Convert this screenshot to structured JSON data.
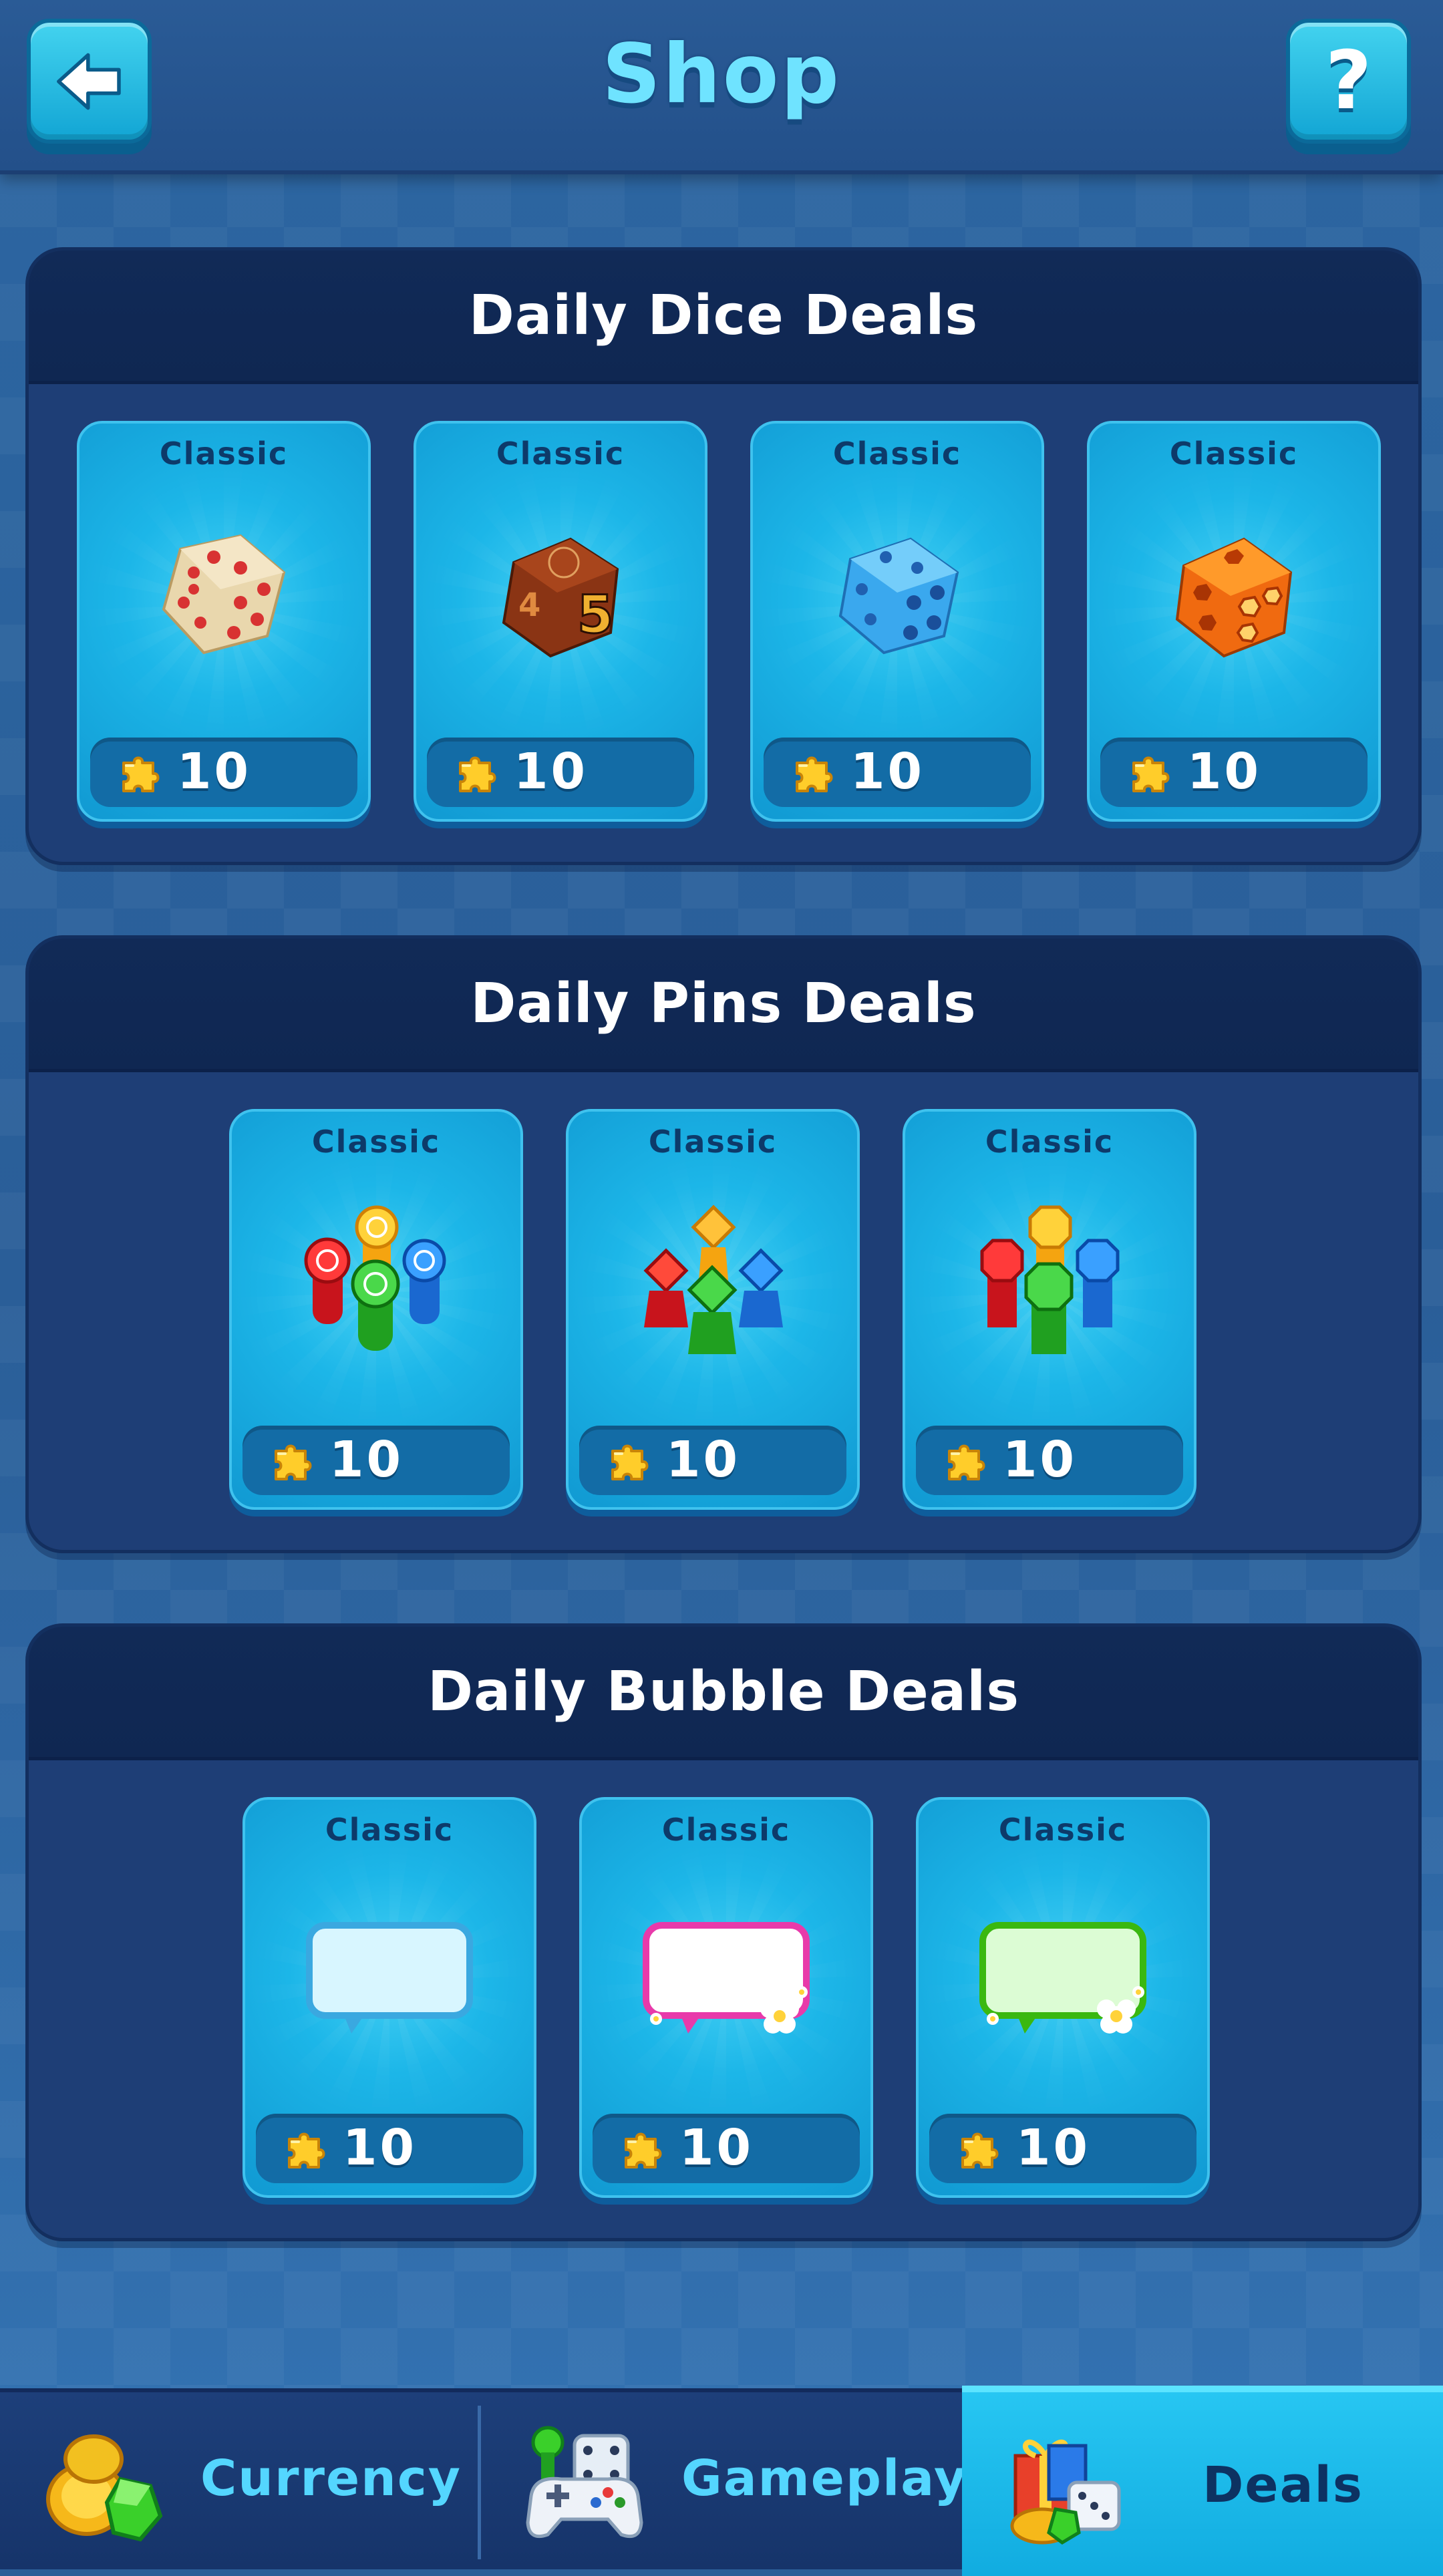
{
  "header": {
    "title": "Shop",
    "back_icon": "arrow-left-icon",
    "help_label": "?"
  },
  "sections": [
    {
      "title": "Daily Dice Deals",
      "items": [
        {
          "label": "Classic",
          "item": "white dice with red pips",
          "price": "10"
        },
        {
          "label": "Classic",
          "item": "brown dice with numbers",
          "price": "10"
        },
        {
          "label": "Classic",
          "item": "blue dice with dark blue pips",
          "price": "10"
        },
        {
          "label": "Classic",
          "item": "orange dice with hexagon pips",
          "price": "10"
        }
      ]
    },
    {
      "title": "Daily Pins Deals",
      "items": [
        {
          "label": "Classic",
          "item": "round pins set",
          "price": "10"
        },
        {
          "label": "Classic",
          "item": "diamond pins set",
          "price": "10"
        },
        {
          "label": "Classic",
          "item": "octagon pins set",
          "price": "10"
        }
      ]
    },
    {
      "title": "Daily Bubble Deals",
      "items": [
        {
          "label": "Classic",
          "item": "light blue chat bubble",
          "price": "10"
        },
        {
          "label": "Classic",
          "item": "pink chat bubble with flowers",
          "price": "10"
        },
        {
          "label": "Classic",
          "item": "green chat bubble with flowers",
          "price": "10"
        }
      ]
    }
  ],
  "price_icon": "puzzle-piece-icon",
  "bottom_nav": {
    "tabs": [
      {
        "label": "Currency",
        "icon": "coins-gems-icon",
        "active": false
      },
      {
        "label": "Gameplay",
        "icon": "gamepad-dice-icon",
        "active": false
      },
      {
        "label": "Deals",
        "icon": "gift-deals-icon",
        "active": true
      }
    ]
  },
  "colors": {
    "accent": "#6fe3ff",
    "card": "#1cb6e8",
    "section_bg": "#1e3e76",
    "active_tab": "#1bb8ea"
  }
}
